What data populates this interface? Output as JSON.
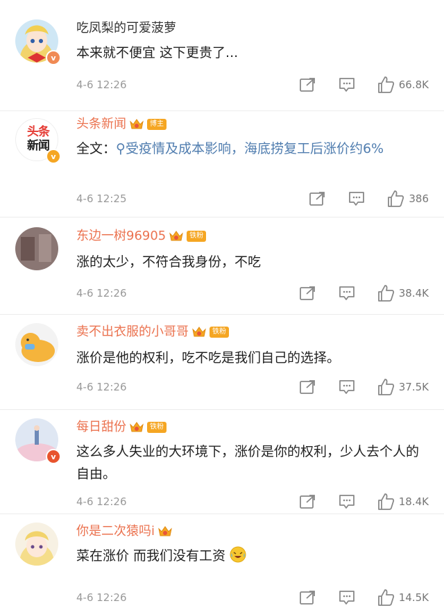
{
  "comments": [
    {
      "name": "吃凤梨的可爱菠萝",
      "text": "本来就不便宜 这下更贵了...",
      "time": "4-6 12:26",
      "likes": "66.8K"
    },
    {
      "name": "头条新闻",
      "badge": "博主",
      "text_prefix": "全文：",
      "link": "受疫情及成本影响，海底捞复工后涨价约6%",
      "time": "4-6 12:25",
      "likes": "386"
    },
    {
      "name": "东边一树96905",
      "badge": "铁粉",
      "text": "涨的太少，不符合我身份，不吃",
      "time": "4-6 12:26",
      "likes": "38.4K"
    },
    {
      "name": "卖不出衣服的小哥哥",
      "badge": "铁粉",
      "text": "涨价是他的权利，吃不吃是我们自己的选择。",
      "time": "4-6 12:26",
      "likes": "37.5K"
    },
    {
      "name": "每日甜份",
      "badge": "铁粉",
      "text": "这么多人失业的大环境下，涨价是你的权利，少人去个人的自由。",
      "time": "4-6 12:26",
      "likes": "18.4K"
    },
    {
      "name": "你是二次猿吗i",
      "text": "菜在涨价 而我们没有工资",
      "time": "4-6 12:26",
      "likes": "14.5K"
    }
  ],
  "avatar_texts": {
    "toutiao": "头条新闻"
  },
  "colors": {
    "orange_name": "#eb7350",
    "badge": "#f5a623",
    "link": "#507daf",
    "vip": "#f08a54",
    "verified": "#f5a623"
  },
  "icons": {
    "share": "share-icon",
    "comment": "comment-icon",
    "like": "like-icon",
    "crown": "crown-icon",
    "emoji": "laugh-cry-emoji-icon"
  }
}
